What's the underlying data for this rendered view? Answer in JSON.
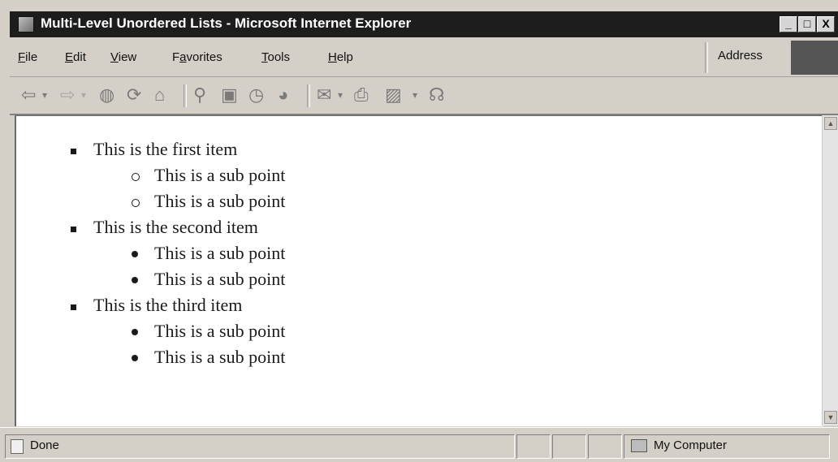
{
  "window": {
    "title": "Multi-Level Unordered Lists - Microsoft Internet Explorer",
    "controls": [
      "_",
      "□",
      "X"
    ]
  },
  "menu": {
    "items": [
      {
        "first": "F",
        "rest": "ile"
      },
      {
        "first": "E",
        "rest": "dit"
      },
      {
        "first": "V",
        "rest": "iew"
      },
      {
        "pre": "F",
        "first": "a",
        "rest": "vorites"
      },
      {
        "first": "T",
        "rest": "ools"
      },
      {
        "first": "H",
        "rest": "elp"
      }
    ],
    "address_pre": "A",
    "address_u": "d",
    "address_rest": "dress"
  },
  "toolbar": {
    "icons": [
      "back-icon",
      "forward-icon",
      "stop-icon",
      "refresh-icon",
      "home-icon",
      "search-icon",
      "favorites-icon",
      "history-icon",
      "mail-icon",
      "print-icon",
      "edit-icon",
      "discuss-icon",
      "messenger-icon"
    ]
  },
  "content": {
    "list": [
      {
        "text": "This is the first item",
        "bullet": "square",
        "children": [
          {
            "text": "This is a sub point",
            "bullet": "circle"
          },
          {
            "text": "This is a sub point",
            "bullet": "circle"
          }
        ]
      },
      {
        "text": "This is the second item",
        "bullet": "square",
        "children": [
          {
            "text": "This is a sub point",
            "bullet": "disc"
          },
          {
            "text": "This is a sub point",
            "bullet": "disc"
          }
        ]
      },
      {
        "text": "This is the third item",
        "bullet": "square",
        "children": [
          {
            "text": "This is a sub point",
            "bullet": "disc"
          },
          {
            "text": "This is a sub point",
            "bullet": "disc"
          }
        ]
      }
    ]
  },
  "status": {
    "left": "Done",
    "zone": "My Computer"
  }
}
